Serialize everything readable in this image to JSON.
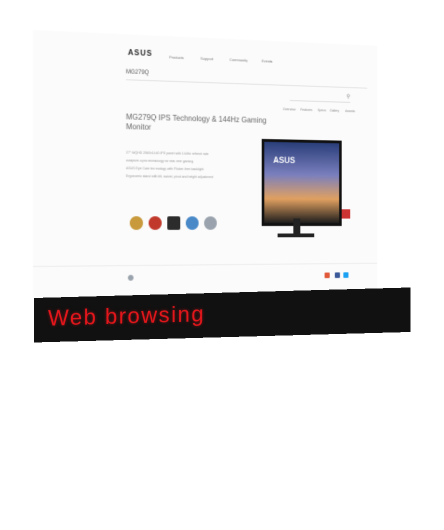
{
  "browser_page": {
    "logo": "ASUS",
    "product_name": "MG279Q",
    "nav_items": [
      "Products",
      "Support",
      "Community",
      "Events"
    ],
    "subnav_items": [
      "Overview",
      "Features",
      "Specs",
      "Gallery",
      "Awards"
    ],
    "title": "MG279Q IPS Technology & 144Hz Gaming Monitor",
    "bullets": [
      "27\" WQHD 2560x1440 IPS panel with 144Hz refresh rate",
      "Adaptive-Sync technology for tear-free gaming",
      "ASUS Eye Care technology with Flicker-free backlight",
      "Ergonomic stand with tilt, swivel, pivot and height adjustment"
    ],
    "colors": {
      "badge1": "#c89a3c",
      "badge2": "#c0392b",
      "badge3": "#2c2c2c",
      "badge4": "#4a89c8",
      "badge5": "#9aa3ad"
    }
  },
  "caption": {
    "text": "Web browsing",
    "color": "#e3161b"
  }
}
